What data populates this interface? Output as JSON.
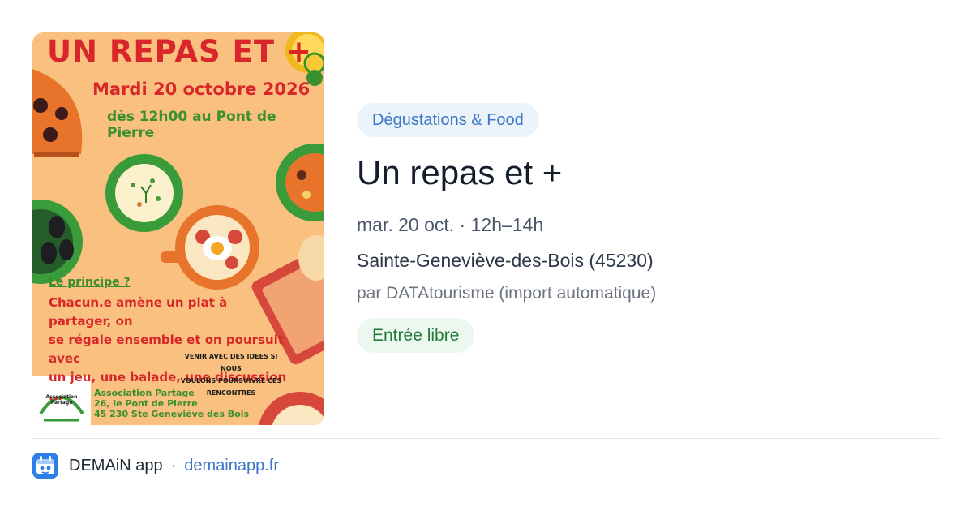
{
  "poster": {
    "headline": "UN REPAS ET +",
    "date_line": "Mardi 20 octobre 2026",
    "time_place": "dès 12h00 au Pont de Pierre",
    "principle_title": "Le principe ?",
    "principle_lines": [
      "Chacun.e amène un plat à partager, on",
      "se régale ensemble et on poursuit avec",
      "un jeu, une balade, une discussion ..."
    ],
    "ideas_lines": [
      "VENIR AVEC DES IDEES SI NOUS",
      "VOULONS POURSUIVRE CES",
      "RENCONTRES"
    ],
    "logo_text": [
      "Association",
      "Partage"
    ],
    "address_lines": [
      "Association Partage",
      "26, le Pont de Pierre",
      "45 230 Ste Geneviève des Bois"
    ]
  },
  "event": {
    "category": "Dégustations & Food",
    "title": "Un repas et +",
    "datetime": "mar. 20 oct. · 12h–14h",
    "location": "Sainte-Geneviève-des-Bois (45230)",
    "source": "par DATAtourisme (import automatique)",
    "price": "Entrée libre"
  },
  "footer": {
    "app_name": "DEMAiN app",
    "separator": "·",
    "url": "demainapp.fr"
  },
  "colors": {
    "poster_bg": "#f9c07f",
    "headline": "#d8262b",
    "time_place": "#3a8f2e",
    "tag_text": "#3a76c4",
    "badge_text": "#237a3a",
    "app_icon": "#2f7fe8"
  }
}
